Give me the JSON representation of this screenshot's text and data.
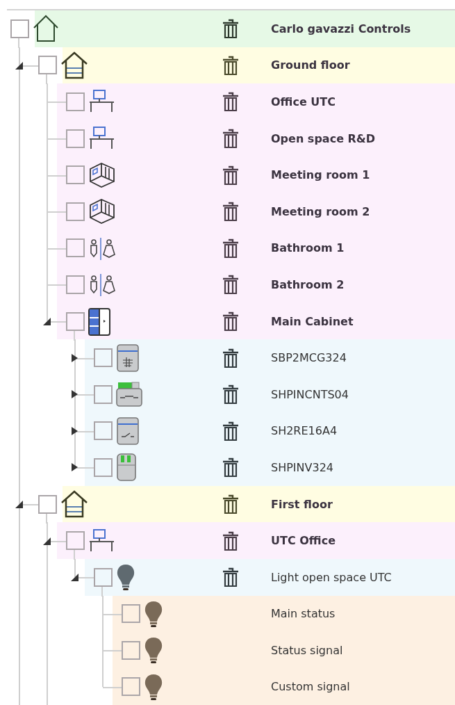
{
  "tree": [
    {
      "label": "Carlo gavazzi Controls",
      "kind": "site",
      "checked": false,
      "deletable": true,
      "children_continue": true,
      "children": [
        {
          "label": "Ground floor",
          "kind": "floor",
          "checked": false,
          "deletable": true,
          "expanded": true,
          "children_continue": false,
          "children": [
            {
              "label": "Office UTC",
              "kind": "office",
              "checked": false,
              "deletable": true
            },
            {
              "label": "Open space R&D",
              "kind": "office",
              "checked": false,
              "deletable": true
            },
            {
              "label": "Meeting room 1",
              "kind": "meeting_room",
              "checked": false,
              "deletable": true
            },
            {
              "label": "Meeting room 2",
              "kind": "meeting_room",
              "checked": false,
              "deletable": true
            },
            {
              "label": "Bathroom 1",
              "kind": "bathroom",
              "checked": false,
              "deletable": true
            },
            {
              "label": "Bathroom 2",
              "kind": "bathroom",
              "checked": false,
              "deletable": true
            },
            {
              "label": "Main Cabinet",
              "kind": "cabinet",
              "checked": false,
              "deletable": true,
              "expanded": true,
              "children_continue": false,
              "children": [
                {
                  "label": "SBP2MCG324",
                  "kind": "module_filter",
                  "checked": false,
                  "deletable": true,
                  "expanded": false
                },
                {
                  "label": "SHPINCNTS04",
                  "kind": "module_contact",
                  "checked": false,
                  "deletable": true,
                  "expanded": false
                },
                {
                  "label": "SH2RE16A4",
                  "kind": "module_switch",
                  "checked": false,
                  "deletable": true,
                  "expanded": false
                },
                {
                  "label": "SHPINV324",
                  "kind": "module_led",
                  "checked": false,
                  "deletable": true,
                  "expanded": false
                }
              ]
            }
          ]
        },
        {
          "label": "First floor",
          "kind": "floor",
          "checked": false,
          "deletable": true,
          "expanded": true,
          "children_continue": true,
          "children": [
            {
              "label": "UTC Office",
              "kind": "office",
              "checked": false,
              "deletable": true,
              "expanded": true,
              "children_continue": false,
              "children": [
                {
                  "label": "Light open space UTC",
                  "kind": "light",
                  "checked": false,
                  "deletable": true,
                  "expanded": true,
                  "children_continue": false,
                  "children": [
                    {
                      "label": "Main status",
                      "kind": "signal",
                      "checked": false,
                      "deletable": false
                    },
                    {
                      "label": "Status signal",
                      "kind": "signal",
                      "checked": false,
                      "deletable": false
                    },
                    {
                      "label": "Custom signal",
                      "kind": "signal",
                      "checked": false,
                      "deletable": false
                    }
                  ]
                }
              ]
            }
          ]
        }
      ]
    }
  ]
}
